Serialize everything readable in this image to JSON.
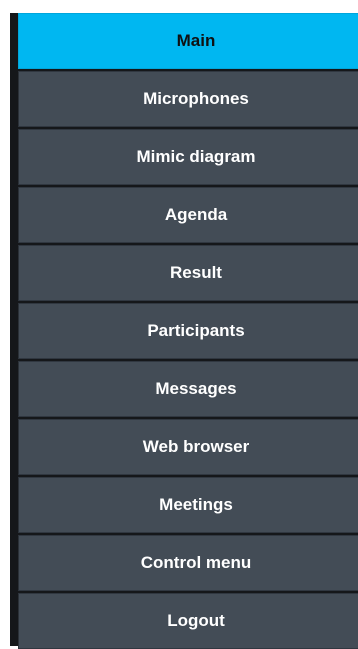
{
  "nav": {
    "items": [
      {
        "label": "Main",
        "active": true
      },
      {
        "label": "Microphones",
        "active": false
      },
      {
        "label": "Mimic diagram",
        "active": false
      },
      {
        "label": "Agenda",
        "active": false
      },
      {
        "label": "Result",
        "active": false
      },
      {
        "label": "Participants",
        "active": false
      },
      {
        "label": "Messages",
        "active": false
      },
      {
        "label": "Web browser",
        "active": false
      },
      {
        "label": "Meetings",
        "active": false
      },
      {
        "label": "Control menu",
        "active": false
      },
      {
        "label": "Logout",
        "active": false
      }
    ]
  },
  "colors": {
    "active_background": "#00b7f1",
    "item_background": "#434c56",
    "sidebar_edge": "#15171a",
    "active_text": "#0f1113",
    "item_text": "#ffffff"
  }
}
